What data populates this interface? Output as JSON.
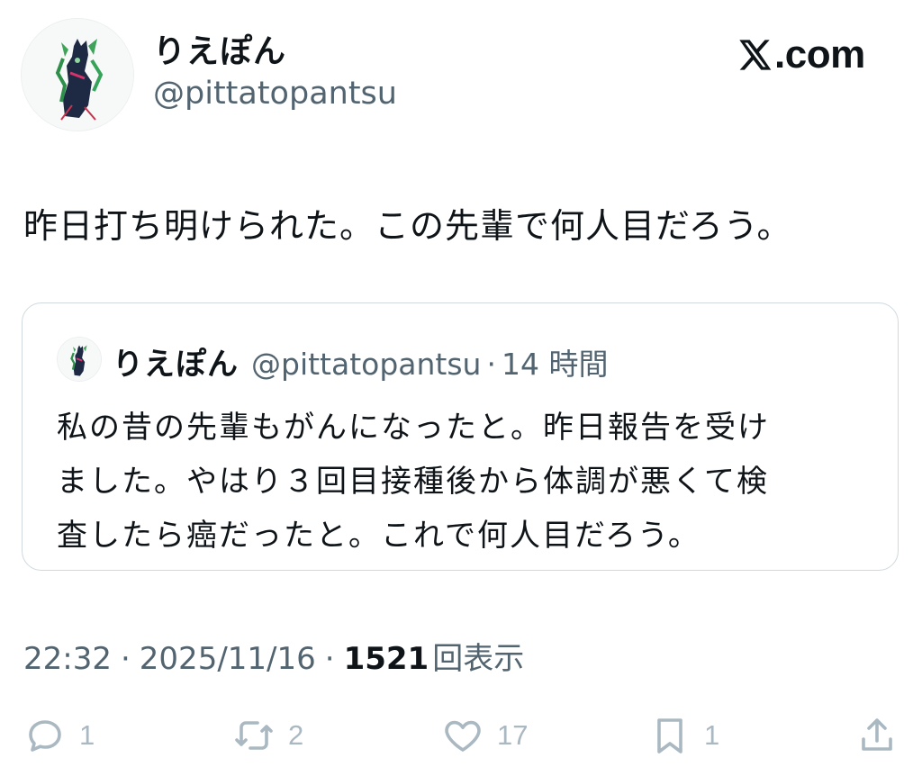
{
  "author": {
    "display_name": "りえぽん",
    "handle": "@pittatopantsu"
  },
  "brand": {
    "label": ".com"
  },
  "tweet": {
    "text": "昨日打ち明けられた。この先輩で何人目だろう。"
  },
  "quoted": {
    "display_name": "りえぽん",
    "handle": "@pittatopantsu",
    "separator": "·",
    "time": "14 時間",
    "lines": [
      "私の昔の先輩もがんになったと。昨日報告を受け",
      "ました。やはり３回目接種後から体調が悪くて検",
      "査したら癌だったと。これで何人目だろう。"
    ]
  },
  "meta": {
    "time": "22:32",
    "separator": "·",
    "date": "2025/11/16",
    "views_count": "1521",
    "views_label": "回表示"
  },
  "actions": {
    "reply": {
      "icon": "reply-icon",
      "count": "1"
    },
    "retweet": {
      "icon": "retweet-icon",
      "count": "2"
    },
    "like": {
      "icon": "heart-icon",
      "count": "17"
    },
    "bookmark": {
      "icon": "bookmark-icon",
      "count": "1"
    },
    "share": {
      "icon": "share-icon"
    }
  },
  "colors": {
    "text": "#0f1419",
    "secondary": "#536471",
    "icon": "#aab8c2",
    "border": "#cfd9de"
  }
}
